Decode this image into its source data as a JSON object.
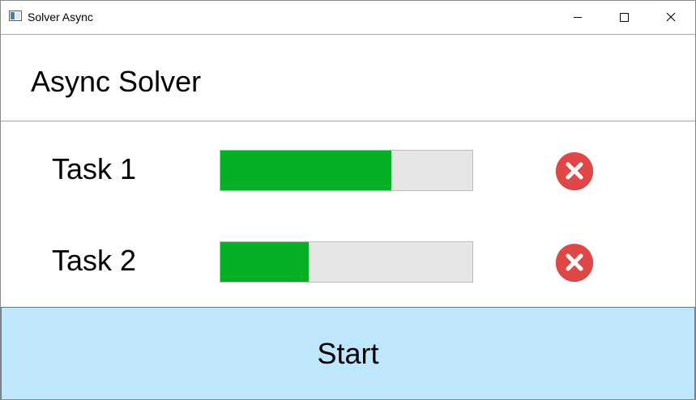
{
  "window": {
    "title": "Solver Async",
    "controls": {
      "minimize_icon": "minimize-icon",
      "maximize_icon": "maximize-icon",
      "close_icon": "close-icon"
    }
  },
  "header": {
    "title": "Async Solver"
  },
  "tasks": [
    {
      "label": "Task 1",
      "progress": 0.68,
      "cancel_icon": "cancel-icon"
    },
    {
      "label": "Task 2",
      "progress": 0.35,
      "cancel_icon": "cancel-icon"
    }
  ],
  "start_button": {
    "label": "Start"
  },
  "colors": {
    "progress_fill": "#06b025",
    "progress_track": "#e6e6e6",
    "cancel_red": "#e04848",
    "start_bg": "#bee6fd",
    "start_border": "#3c7fb1"
  }
}
